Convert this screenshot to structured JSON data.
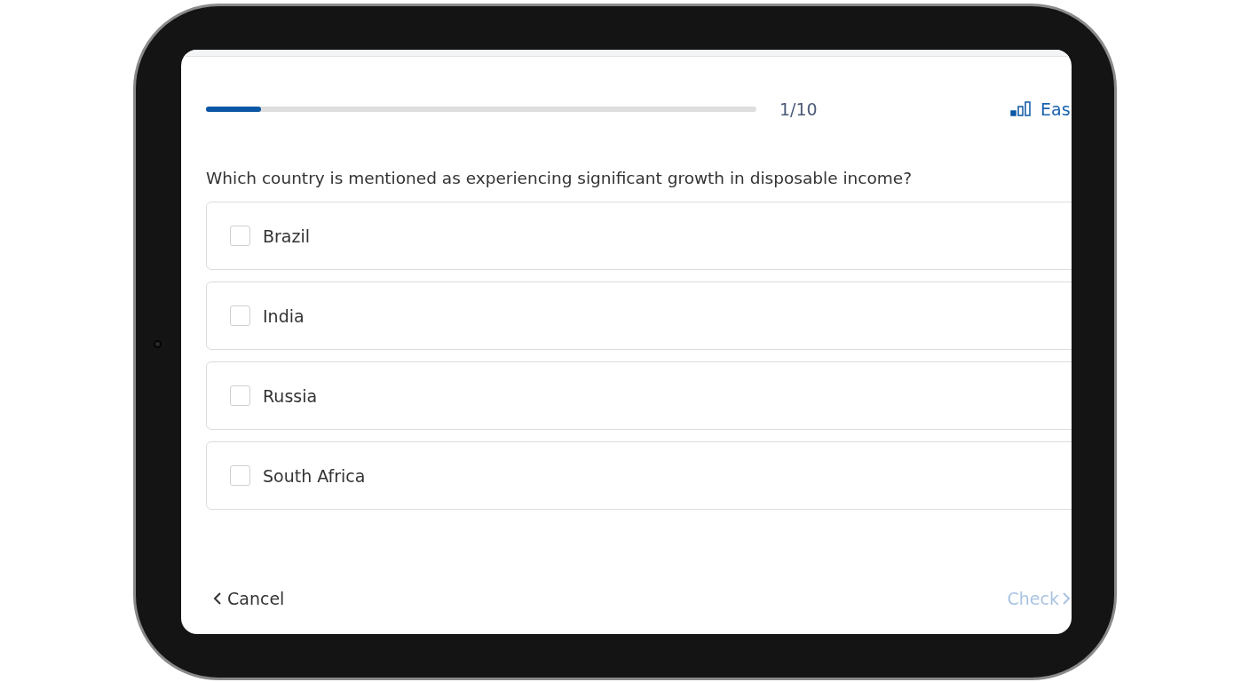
{
  "progress": {
    "level": 0.1,
    "counter": "1/10"
  },
  "difficulty": {
    "label": "Eas"
  },
  "question": "Which country is mentioned as experiencing significant growth in disposable income?",
  "options": [
    {
      "label": "Brazil",
      "checked": false
    },
    {
      "label": "India",
      "checked": false
    },
    {
      "label": "Russia",
      "checked": false
    },
    {
      "label": "South Africa",
      "checked": false
    }
  ],
  "footer": {
    "cancel": "Cancel",
    "check": "Check",
    "check_disabled": true
  }
}
